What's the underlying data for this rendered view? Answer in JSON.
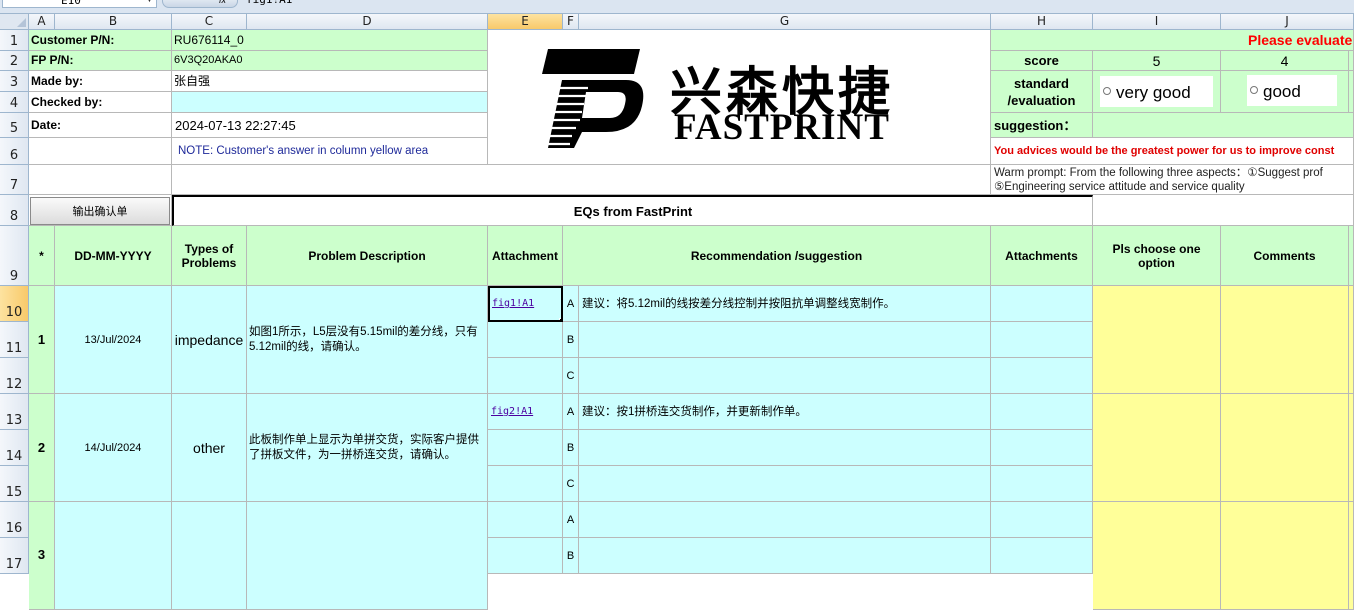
{
  "formula_bar": {
    "name_box": "E10",
    "formula": "fig1!A1"
  },
  "columns": [
    "A",
    "B",
    "C",
    "D",
    "E",
    "F",
    "G",
    "H",
    "I",
    "J"
  ],
  "rows": [
    "1",
    "2",
    "3",
    "4",
    "5",
    "6",
    "7",
    "8",
    "9",
    "10",
    "11",
    "12",
    "13",
    "14",
    "15",
    "16",
    "17"
  ],
  "header": {
    "customer_pn_label": "Customer P/N:",
    "customer_pn": "RU676114_0",
    "fp_pn_label": "FP P/N:",
    "fp_pn": "6V3Q20AKA0",
    "made_by_label": "Made by:",
    "made_by": "张自强",
    "checked_by_label": "Checked by:",
    "checked_by": "",
    "date_label": "Date:",
    "date": "2024-07-13 22:27:45",
    "note": "NOTE: Customer's  answer in column yellow area"
  },
  "logo": {
    "cn": "兴森快捷",
    "en": "FASTPRINT"
  },
  "evaluation": {
    "title": "Please evaluate",
    "score_label": "score",
    "score_5": "5",
    "score_4": "4",
    "standard_label": "standard\n/evaluation",
    "option_very_good": "very good",
    "option_good": "good",
    "suggestion_label": "suggestion：",
    "advice": "You advices would be the greatest power for us to improve const",
    "warm_prompt_1": "Warm prompt:  From the following three aspects：①Suggest prof",
    "warm_prompt_2": "⑤Engineering service attitude and service quality"
  },
  "export_button": "输出确认单",
  "eq_title": "EQs from FastPrint",
  "table_headers": {
    "star": "*",
    "date": "DD-MM-YYYY",
    "types": "Types of Problems",
    "description": "Problem Description",
    "attachment": "Attachment",
    "recommendation": "Recommendation /suggestion",
    "attachments": "Attachments",
    "choose": "Pls choose one option",
    "comments": "Comments"
  },
  "eqs": [
    {
      "no": "1",
      "date": "13/Jul/2024",
      "type": "impedance",
      "description": "如图1所示，L5层没有5.15mil的差分线，只有5.12mil的线，请确认。",
      "attachment": "fig1!A1",
      "options": [
        {
          "letter": "A",
          "text": "建议：将5.12mil的线按差分线控制并按阻抗单调整线宽制作。"
        },
        {
          "letter": "B",
          "text": ""
        },
        {
          "letter": "C",
          "text": ""
        }
      ]
    },
    {
      "no": "2",
      "date": "14/Jul/2024",
      "type": "other",
      "description": "此板制作单上显示为单拼交货，实际客户提供了拼板文件，为一拼桥连交货，请确认。",
      "attachment": "fig2!A1",
      "options": [
        {
          "letter": "A",
          "text": "建议：按1拼桥连交货制作，并更新制作单。"
        },
        {
          "letter": "B",
          "text": ""
        },
        {
          "letter": "C",
          "text": ""
        }
      ]
    },
    {
      "no": "3",
      "date": "",
      "type": "",
      "description": "",
      "attachment": "",
      "options": [
        {
          "letter": "A",
          "text": ""
        },
        {
          "letter": "B",
          "text": ""
        }
      ]
    }
  ]
}
